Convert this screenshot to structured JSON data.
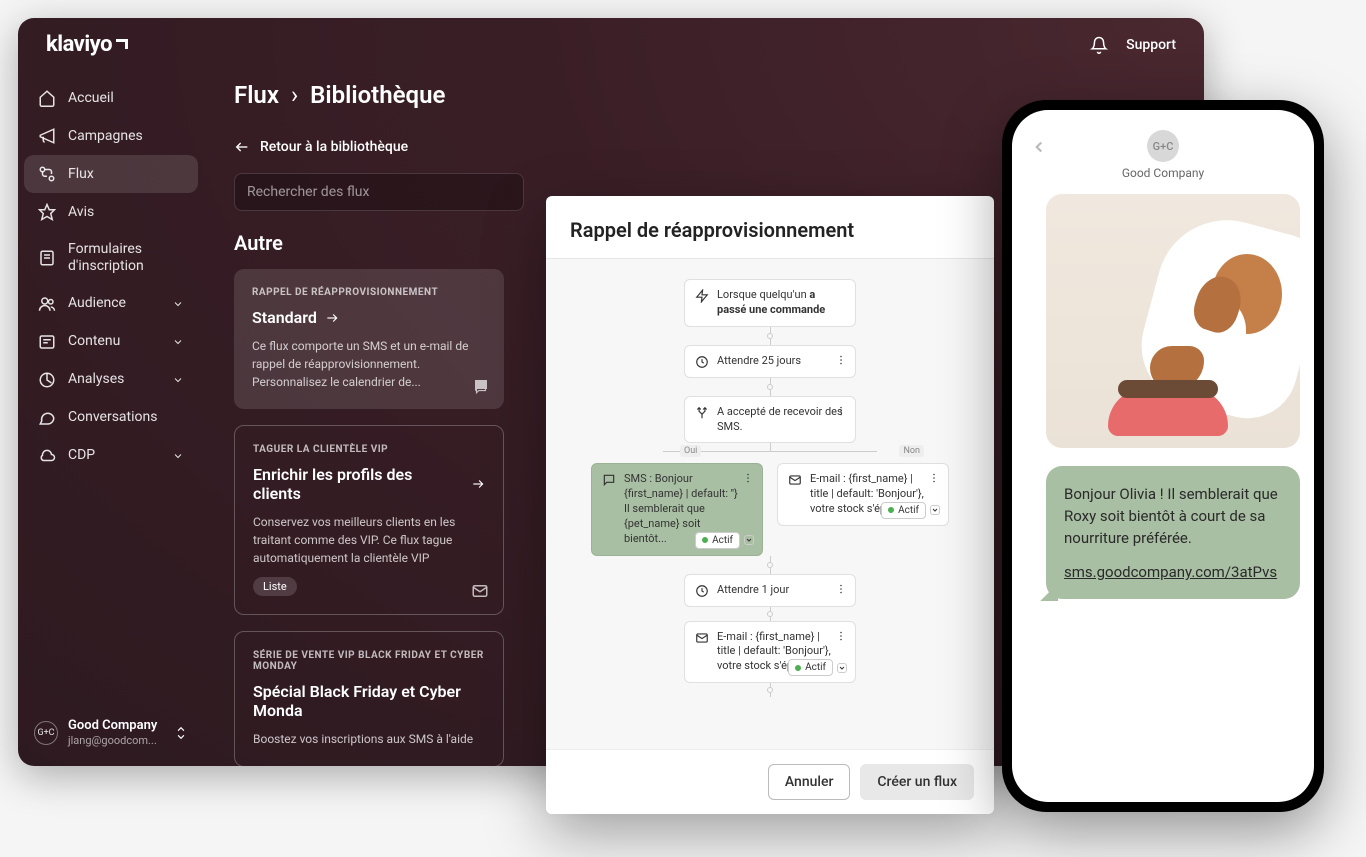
{
  "header": {
    "logo": "klaviyo",
    "support": "Support"
  },
  "sidebar": {
    "items": [
      {
        "label": "Accueil",
        "icon": "home"
      },
      {
        "label": "Campagnes",
        "icon": "megaphone"
      },
      {
        "label": "Flux",
        "icon": "flow",
        "active": true
      },
      {
        "label": "Avis",
        "icon": "star"
      },
      {
        "label": "Formulaires d'inscription",
        "icon": "form"
      },
      {
        "label": "Audience",
        "icon": "people",
        "expandable": true
      },
      {
        "label": "Contenu",
        "icon": "content",
        "expandable": true
      },
      {
        "label": "Analyses",
        "icon": "analytics",
        "expandable": true
      },
      {
        "label": "Conversations",
        "icon": "chat"
      },
      {
        "label": "CDP",
        "icon": "cloud",
        "expandable": true
      }
    ]
  },
  "account": {
    "badge": "G+C",
    "name": "Good Company",
    "email": "jlang@goodcom..."
  },
  "breadcrumb": {
    "root": "Flux",
    "current": "Bibliothèque"
  },
  "back_link": "Retour à la bibliothèque",
  "search": {
    "placeholder": "Rechercher des flux"
  },
  "section_title": "Autre",
  "cards": [
    {
      "eyebrow": "RAPPEL DE RÉAPPROVISIONNEMENT",
      "title": "Standard",
      "desc": "Ce flux comporte un SMS et un e-mail de rappel de réapprovisionnement. Personnalisez le calendrier de...",
      "corner_icon": "sms"
    },
    {
      "eyebrow": "TAGUER LA CLIENTÈLE VIP",
      "title": "Enrichir les profils des clients",
      "desc": "Conservez vos meilleurs clients en les traitant comme des VIP. Ce flux tague automatiquement la clientèle VIP",
      "badge": "Liste",
      "corner_icon": "email"
    },
    {
      "eyebrow": "SÉRIE DE VENTE VIP BLACK FRIDAY ET CYBER MONDAY",
      "title": "Spécial Black Friday et Cyber Monda",
      "desc": "Boostez vos inscriptions aux SMS à l'aide"
    }
  ],
  "modal": {
    "title": "Rappel de réapprovisionnement",
    "trigger_prefix": "Lorsque quelqu'un ",
    "trigger_bold": "a passé une commande",
    "wait1": "Attendre 25 jours",
    "consent": "A accepté de recevoir des SMS.",
    "branch_yes": "Oui",
    "branch_no": "Non",
    "sms_node": "SMS : Bonjour {first_name} | default: ''} Il semblerait que {pet_name} soit bientôt...",
    "email_node": "E-mail : {first_name} | title | default: 'Bonjour'}, votre stock s'épuise ?",
    "status_active": "Actif",
    "wait2": "Attendre 1 jour",
    "email_node2": "E-mail : {first_name} | title | default: 'Bonjour'}, votre stock s'épuise ?",
    "cancel": "Annuler",
    "create": "Créer un flux"
  },
  "phone": {
    "avatar": "G+C",
    "sender": "Good Company",
    "message": "Bonjour Olivia ! Il semblerait que Roxy soit bientôt à court de sa nourriture préférée.",
    "link": "sms.goodcompany.com/3atPvs"
  }
}
